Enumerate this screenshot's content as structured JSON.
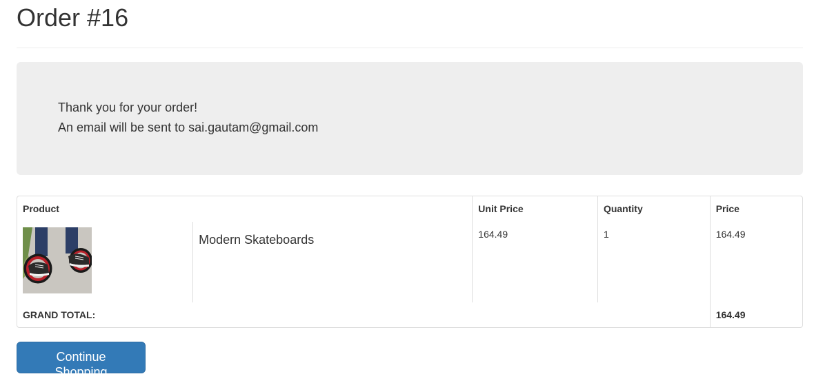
{
  "page": {
    "title": "Order #16"
  },
  "confirmation": {
    "line1": "Thank you for your order!",
    "line2": "An email will be sent to sai.gautam@gmail.com"
  },
  "table": {
    "headers": {
      "product": "Product",
      "unit_price": "Unit Price",
      "quantity": "Quantity",
      "price": "Price"
    },
    "rows": [
      {
        "image_alt": "Modern Skateboards",
        "name": "Modern Skateboards",
        "unit_price": "164.49",
        "quantity": "1",
        "price": "164.49"
      }
    ],
    "footer": {
      "label": "GRAND TOTAL:",
      "total": "164.49"
    }
  },
  "actions": {
    "continue_label": "Continue Shopping"
  },
  "colors": {
    "primary": "#337ab7",
    "jumbotron_bg": "#eeeeee",
    "text": "#333333",
    "border": "#dddddd"
  }
}
